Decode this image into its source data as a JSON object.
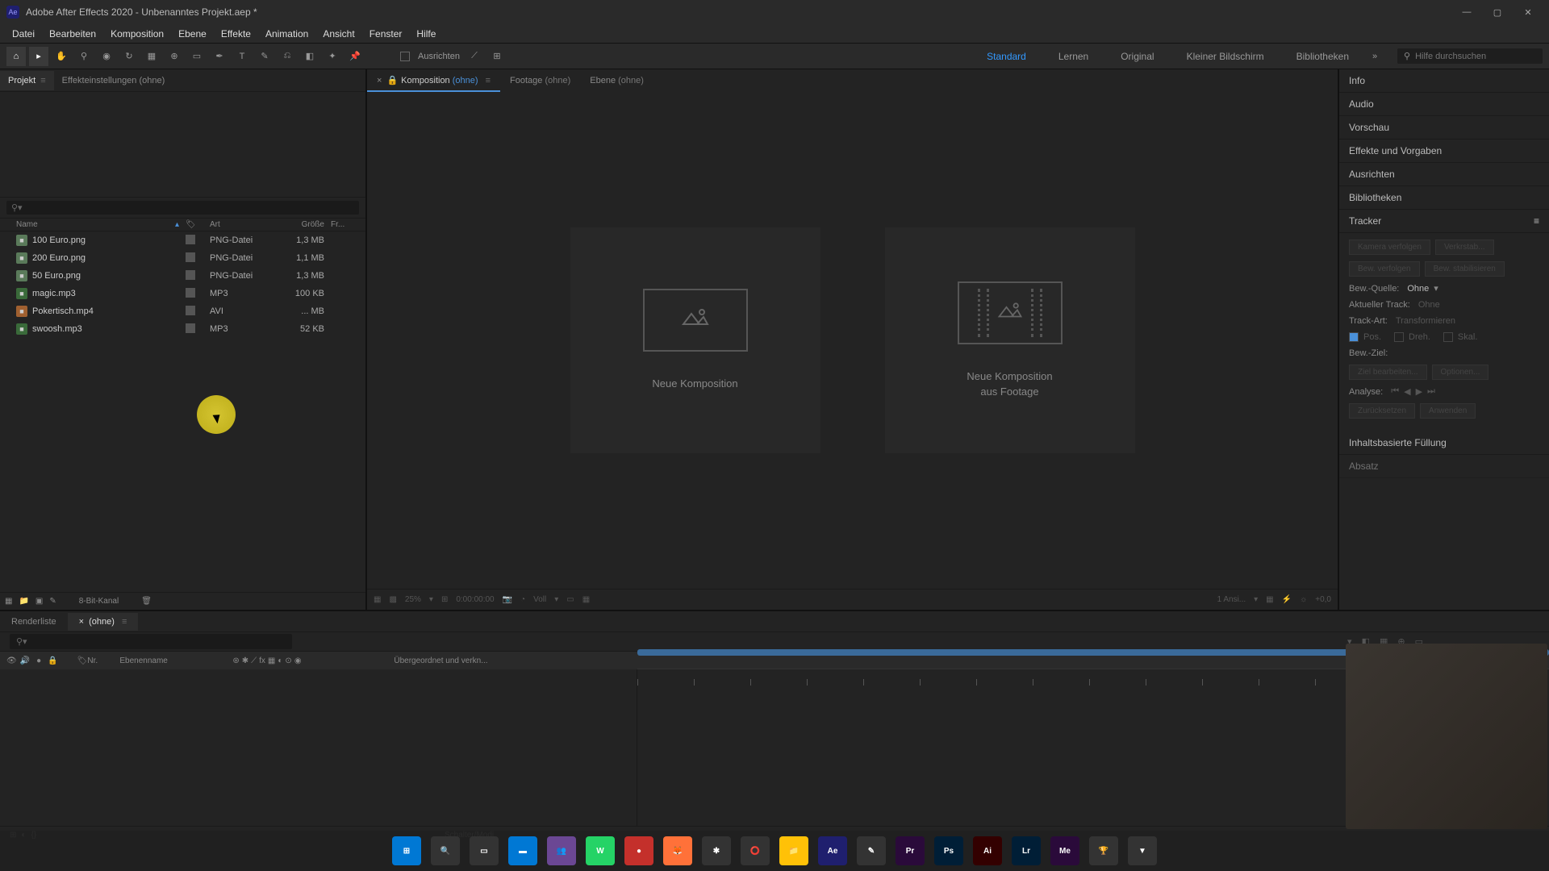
{
  "titlebar": {
    "app_logo_text": "Ae",
    "title": "Adobe After Effects 2020 - Unbenanntes Projekt.aep *"
  },
  "menubar": [
    "Datei",
    "Bearbeiten",
    "Komposition",
    "Ebene",
    "Effekte",
    "Animation",
    "Ansicht",
    "Fenster",
    "Hilfe"
  ],
  "toolbar": {
    "align_label": "Ausrichten",
    "workspaces": [
      "Standard",
      "Lernen",
      "Original",
      "Kleiner Bildschirm",
      "Bibliotheken"
    ],
    "active_workspace": "Standard",
    "search_placeholder": "Hilfe durchsuchen"
  },
  "project": {
    "tabs": [
      {
        "label": "Projekt",
        "active": true
      },
      {
        "label": "Effekteinstellungen (ohne)",
        "active": false
      }
    ],
    "columns": {
      "name": "Name",
      "type": "Art",
      "size": "Größe",
      "fr": "Fr..."
    },
    "files": [
      {
        "name": "100 Euro.png",
        "type": "PNG-Datei",
        "size": "1,3 MB",
        "icon": "png"
      },
      {
        "name": "200 Euro.png",
        "type": "PNG-Datei",
        "size": "1,1 MB",
        "icon": "png"
      },
      {
        "name": "50 Euro.png",
        "type": "PNG-Datei",
        "size": "1,3 MB",
        "icon": "png"
      },
      {
        "name": "magic.mp3",
        "type": "MP3",
        "size": "100 KB",
        "icon": "mp3"
      },
      {
        "name": "Pokertisch.mp4",
        "type": "AVI",
        "size": "... MB",
        "icon": "avi"
      },
      {
        "name": "swoosh.mp3",
        "type": "MP3",
        "size": "52 KB",
        "icon": "mp3"
      }
    ],
    "footer_bits": "8-Bit-Kanal"
  },
  "viewer": {
    "tabs": [
      {
        "prefix": "Komposition",
        "suffix": "(ohne)",
        "active": true,
        "locked": true
      },
      {
        "prefix": "Footage",
        "suffix": "(ohne)",
        "active": false
      },
      {
        "prefix": "Ebene",
        "suffix": "(ohne)",
        "active": false
      }
    ],
    "new_comp": "Neue Komposition",
    "new_comp_footage_l1": "Neue Komposition",
    "new_comp_footage_l2": "aus Footage",
    "footer": {
      "pct": "25%",
      "time": "0:00:00:00",
      "res": "Voll",
      "views": "1 Ansi...",
      "exp": "+0,0"
    }
  },
  "right": {
    "panels": [
      "Info",
      "Audio",
      "Vorschau",
      "Effekte und Vorgaben",
      "Ausrichten",
      "Bibliotheken"
    ],
    "tracker": {
      "title": "Tracker",
      "btn_cam": "Kamera verfolgen",
      "btn_warp": "Verkrstab...",
      "btn_track": "Bew. verfolgen",
      "btn_stab": "Bew. stabilisieren",
      "src_label": "Bew.-Quelle:",
      "src_value": "Ohne",
      "cur_label": "Aktueller Track:",
      "cur_value": "Ohne",
      "type_label": "Track-Art:",
      "type_value": "Transformieren",
      "pos": "Pos.",
      "rot": "Dreh.",
      "scale": "Skal.",
      "target_label": "Bew.-Ziel:",
      "btn_edit": "Ziel bearbeiten...",
      "btn_opts": "Optionen...",
      "analyze": "Analyse:",
      "btn_reset": "Zurücksetzen",
      "btn_apply": "Anwenden"
    },
    "content_fill": "Inhaltsbasierte Füllung",
    "absatz": "Absatz"
  },
  "timeline": {
    "tabs": [
      {
        "label": "Renderliste",
        "active": false
      },
      {
        "label": "(ohne)",
        "active": true
      }
    ],
    "cols": {
      "num": "Nr.",
      "name": "Ebenenname",
      "parent": "Übergeordnet und verkn..."
    },
    "footer": "Schalter/Modi"
  },
  "taskbar_icons": [
    {
      "bg": "#0078d4",
      "txt": "⊞"
    },
    {
      "bg": "#333",
      "txt": "🔍"
    },
    {
      "bg": "#333",
      "txt": "▭"
    },
    {
      "bg": "#0078d4",
      "txt": "▬"
    },
    {
      "bg": "#6b4794",
      "txt": "👥"
    },
    {
      "bg": "#25d366",
      "txt": "W"
    },
    {
      "bg": "#c4302b",
      "txt": "●"
    },
    {
      "bg": "#ff7139",
      "txt": "🦊"
    },
    {
      "bg": "#333",
      "txt": "✱"
    },
    {
      "bg": "#333",
      "txt": "⭕"
    },
    {
      "bg": "#ffc107",
      "txt": "📁"
    },
    {
      "bg": "#1f1f6e",
      "txt": "Ae"
    },
    {
      "bg": "#333",
      "txt": "✎"
    },
    {
      "bg": "#2a0a3a",
      "txt": "Pr"
    },
    {
      "bg": "#001e36",
      "txt": "Ps"
    },
    {
      "bg": "#330000",
      "txt": "Ai"
    },
    {
      "bg": "#001e36",
      "txt": "Lr"
    },
    {
      "bg": "#2a0a3a",
      "txt": "Me"
    },
    {
      "bg": "#333",
      "txt": "🏆"
    },
    {
      "bg": "#333",
      "txt": "▼"
    }
  ]
}
